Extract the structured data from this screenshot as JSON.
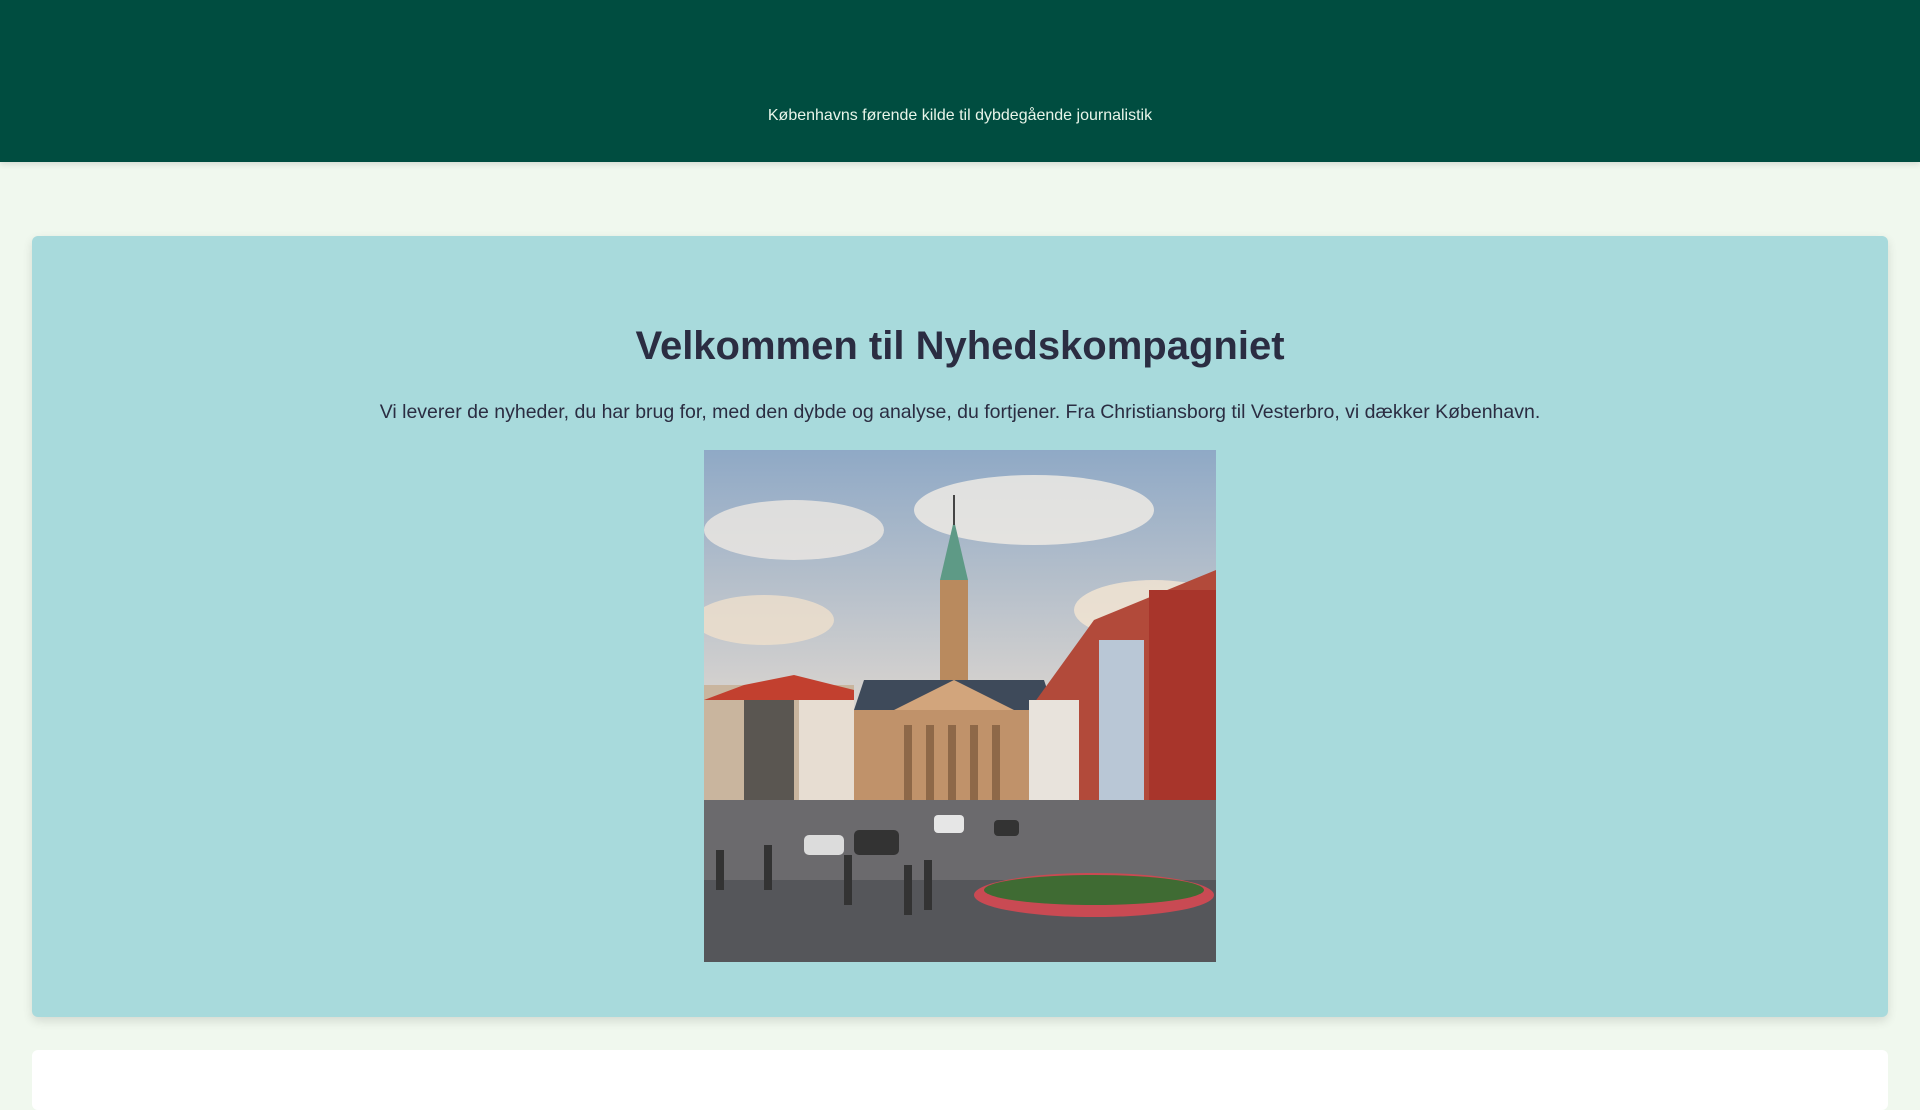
{
  "header": {
    "tagline": "Københavns førende kilde til dybdegående journalistik"
  },
  "hero": {
    "title": "Velkommen til Nyhedskompagniet",
    "description": "Vi leverer de nyheder, du har brug for, med den dybde og analyse, du fortjener. Fra Christiansborg til Vesterbro, vi dækker København."
  },
  "colors": {
    "header": "#004d40",
    "background": "#f0f8ee",
    "hero": "#a8dadc",
    "text": "#2b2d42"
  }
}
